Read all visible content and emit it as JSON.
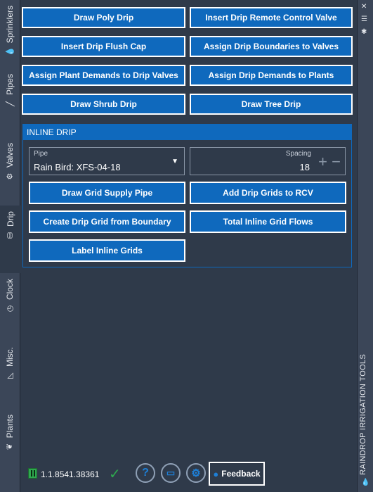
{
  "tabs": [
    {
      "label": "Sprinklers",
      "icon": "droplet-icon"
    },
    {
      "label": "Pipes",
      "icon": "pipe-icon"
    },
    {
      "label": "Valves",
      "icon": "valve-icon"
    },
    {
      "label": "Drip",
      "icon": "drip-icon"
    },
    {
      "label": "Clock",
      "icon": "clock-icon"
    },
    {
      "label": "Misc.",
      "icon": "misc-icon"
    },
    {
      "label": "Plants",
      "icon": "plant-icon"
    }
  ],
  "active_tab": "Drip",
  "buttons": {
    "draw_poly_drip": "Draw Poly Drip",
    "insert_drip_rcv": "Insert Drip Remote Control Valve",
    "insert_flush_cap": "Insert Drip Flush Cap",
    "assign_boundaries": "Assign Drip Boundaries to Valves",
    "assign_plant_demands": "Assign Plant Demands to Drip Valves",
    "assign_drip_demands": "Assign Drip Demands to Plants",
    "draw_shrub_drip": "Draw Shrub Drip",
    "draw_tree_drip": "Draw Tree Drip"
  },
  "inline_drip": {
    "header": "INLINE DRIP",
    "pipe_label": "Pipe",
    "pipe_value": "Rain Bird: XFS-04-18",
    "spacing_label": "Spacing",
    "spacing_value": "18",
    "buttons": {
      "draw_grid_supply": "Draw Grid Supply Pipe",
      "add_grids_rcv": "Add Drip Grids to RCV",
      "create_grid_boundary": "Create Drip Grid from Boundary",
      "total_flows": "Total Inline Grid Flows",
      "label_grids": "Label Inline Grids"
    }
  },
  "right_panel_title": "RAINDROP IRRIGATION TOOLS",
  "status": {
    "version": "1.1.8541.38361",
    "feedback_label": "Feedback"
  },
  "colors": {
    "accent": "#0f69bd",
    "background": "#2f3a4a",
    "tab_bg": "#3b4658",
    "check": "#2fa84f"
  }
}
